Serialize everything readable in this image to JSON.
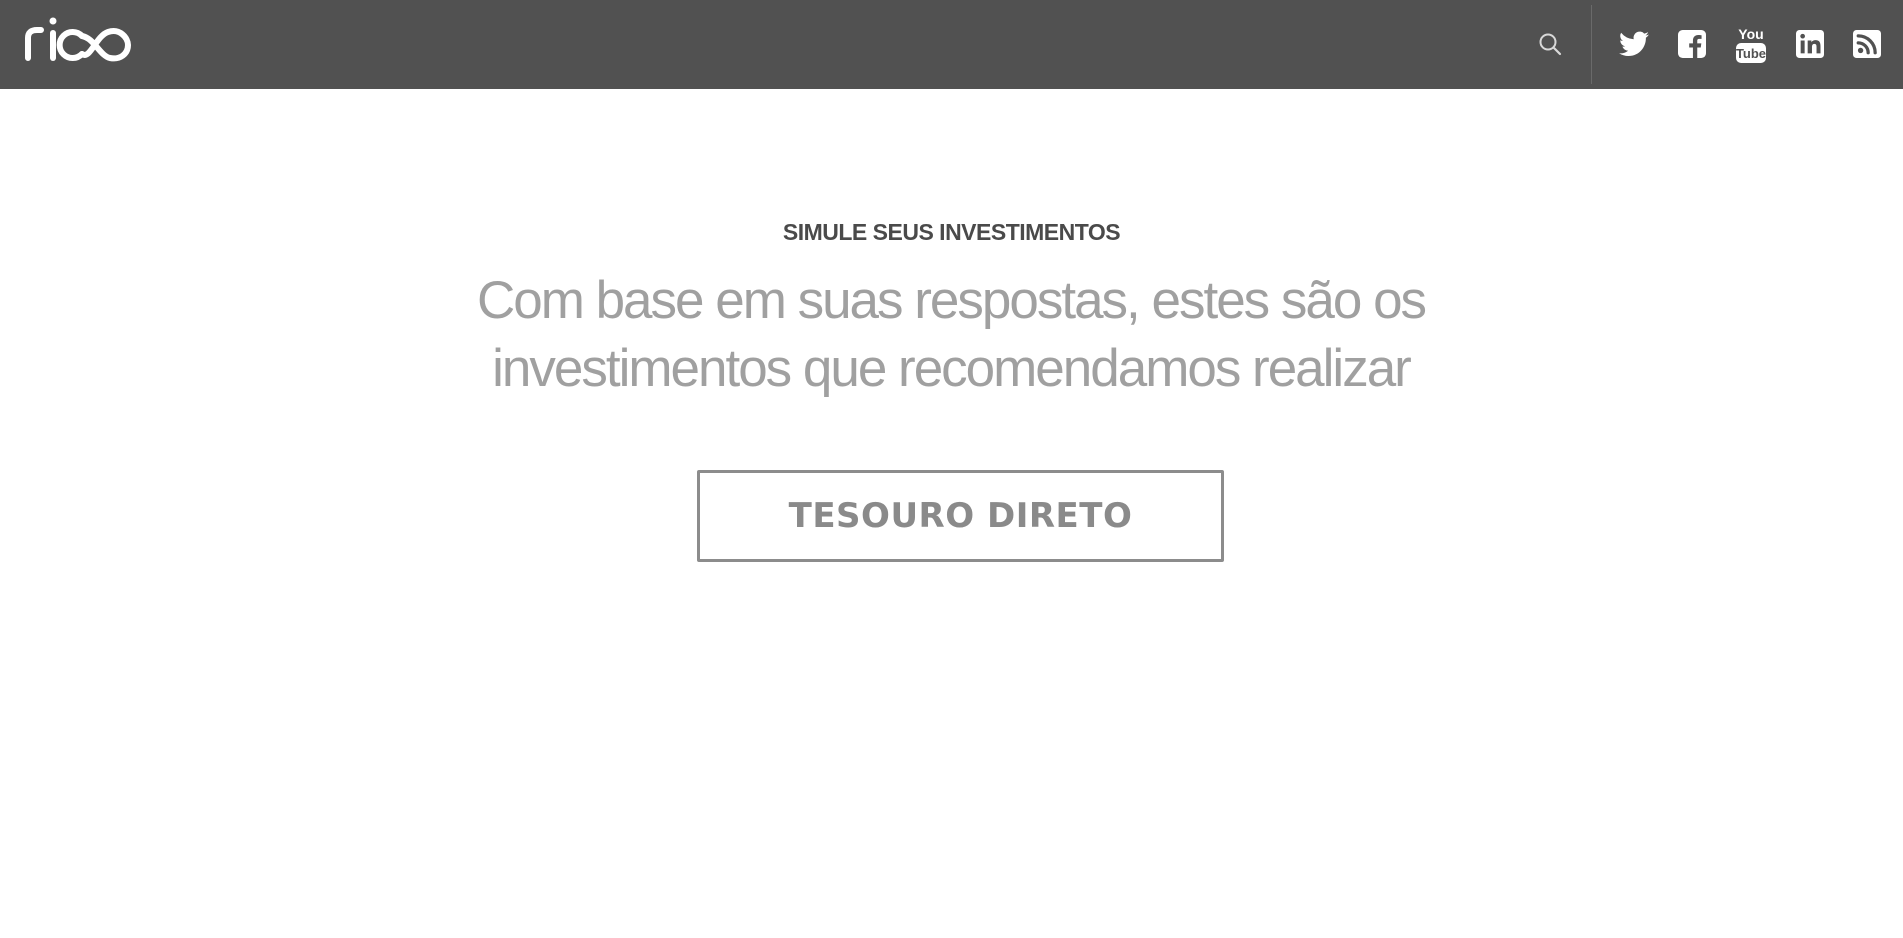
{
  "header": {
    "logo_text": "rico",
    "search_icon": "search-icon",
    "social": [
      {
        "name": "twitter",
        "icon": "twitter-icon"
      },
      {
        "name": "facebook",
        "icon": "facebook-icon"
      },
      {
        "name": "youtube",
        "icon": "youtube-icon"
      },
      {
        "name": "linkedin",
        "icon": "linkedin-icon"
      },
      {
        "name": "rss",
        "icon": "rss-icon"
      }
    ],
    "background": "#515151",
    "icon_color": "#ffffff"
  },
  "main": {
    "eyebrow": "SIMULE SEUS INVESTIMENTOS",
    "headline": "Com base em suas respostas, estes são os investimentos que recomendamos realizar",
    "cta_label": "TESOURO DIRETO"
  },
  "colors": {
    "eyebrow": "#4a4a4a",
    "headline": "#9b9b9b",
    "cta_border": "#8c8c8c",
    "cta_text": "#8a8a8a"
  }
}
